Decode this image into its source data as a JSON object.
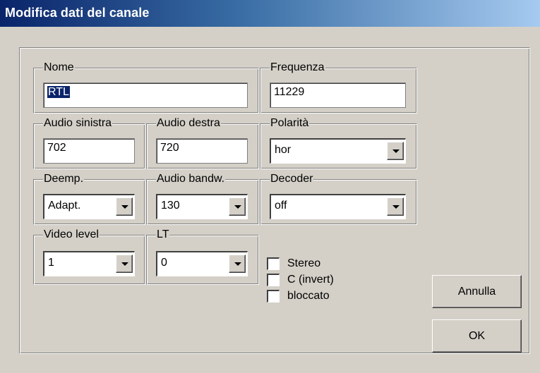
{
  "window": {
    "title": "Modifica dati del canale"
  },
  "groups": {
    "nome": {
      "label": "Nome",
      "value": "RTL"
    },
    "frequenza": {
      "label": "Frequenza",
      "value": "11229"
    },
    "audio_sinistra": {
      "label": "Audio sinistra",
      "value": "702"
    },
    "audio_destra": {
      "label": "Audio destra",
      "value": "720"
    },
    "polarita": {
      "label": "Polarità",
      "value": "hor"
    },
    "deemp": {
      "label": "Deemp.",
      "value": "Adapt."
    },
    "audio_bandw": {
      "label": "Audio bandw.",
      "value": "130"
    },
    "decoder": {
      "label": "Decoder",
      "value": "off"
    },
    "video_level": {
      "label": "Video level",
      "value": "1"
    },
    "lt": {
      "label": "LT",
      "value": "0"
    }
  },
  "checkboxes": {
    "stereo": {
      "label": "Stereo",
      "checked": false
    },
    "c_invert": {
      "label": "C (invert)",
      "checked": false
    },
    "bloccato": {
      "label": "bloccato",
      "checked": false
    }
  },
  "buttons": {
    "cancel": "Annulla",
    "ok": "OK"
  },
  "colors": {
    "face": "#d4d0c8",
    "title_start": "#0a246a",
    "title_end": "#a6caf0",
    "selection": "#0a246a"
  }
}
